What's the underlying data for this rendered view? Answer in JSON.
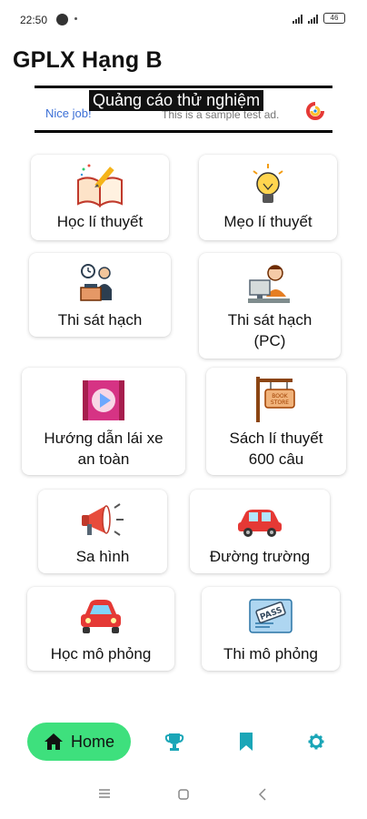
{
  "status_bar": {
    "time": "22:50",
    "battery": "46"
  },
  "app": {
    "title": "GPLX Hạng B"
  },
  "ad": {
    "label": "Quảng cáo thử nghiệm",
    "advertiser": "Nice job!",
    "subtext": "This is a sample test ad."
  },
  "menu": {
    "theory": "Học lí thuyết",
    "tips": "Mẹo lí thuyết",
    "exam": "Thi sát hạch",
    "exam_pc_line1": "Thi sát hạch",
    "exam_pc_line2": "(PC)",
    "safe_driving_line1": "Hướng dẫn lái xe",
    "safe_driving_line2": "an toàn",
    "book_line1": "Sách lí thuyết",
    "book_line2": "600 câu",
    "sa_hinh": "Sa hình",
    "road": "Đường trường",
    "sim_learn": "Học mô phỏng",
    "sim_test": "Thi mô phỏng"
  },
  "nav": {
    "home": "Home",
    "active_color": "#3ee07d",
    "icon_color": "#1aa6b7"
  }
}
